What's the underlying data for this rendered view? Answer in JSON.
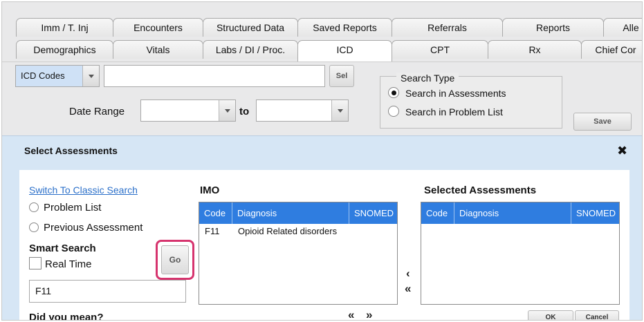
{
  "tabs_row1": [
    "Imm / T. Inj",
    "Encounters",
    "Structured Data",
    "Saved Reports",
    "Referrals",
    "Reports",
    "Alle"
  ],
  "tabs_row2": [
    "Demographics",
    "Vitals",
    "Labs / DI / Proc.",
    "ICD",
    "CPT",
    "Rx",
    "Chief Cor"
  ],
  "active_tab": "ICD",
  "search": {
    "type_value": "ICD Codes",
    "input_value": "",
    "sel_label": "Sel",
    "date_range_label": "Date Range",
    "to_label": "to",
    "date_from": "",
    "date_to": ""
  },
  "search_type": {
    "legend": "Search Type",
    "options": [
      "Search in Assessments",
      "Search in Problem List"
    ],
    "selected_index": 0
  },
  "save_label": "Save",
  "modal": {
    "title": "Select Assessments",
    "close_glyph": "✖",
    "switch_link": "Switch To Classic Search",
    "problem_list": "Problem List",
    "previous_assessment": "Previous Assessment",
    "smart_search": "Smart Search",
    "real_time": "Real Time",
    "go_label": "Go",
    "query": "F11",
    "did_you_mean": "Did you mean?",
    "imo_title": "IMO",
    "selected_title": "Selected Assessments",
    "columns": [
      "Code",
      "Diagnosis",
      "SNOMED"
    ],
    "imo_rows": [
      {
        "code": "F11",
        "diagnosis": "Opioid Related disorders",
        "snomed": ""
      }
    ],
    "selected_rows": [],
    "move_left": "‹",
    "move_all_left": "«",
    "page_prev": "«",
    "page_next": "»",
    "ok_label": "OK",
    "cancel_label": "Cancel"
  }
}
